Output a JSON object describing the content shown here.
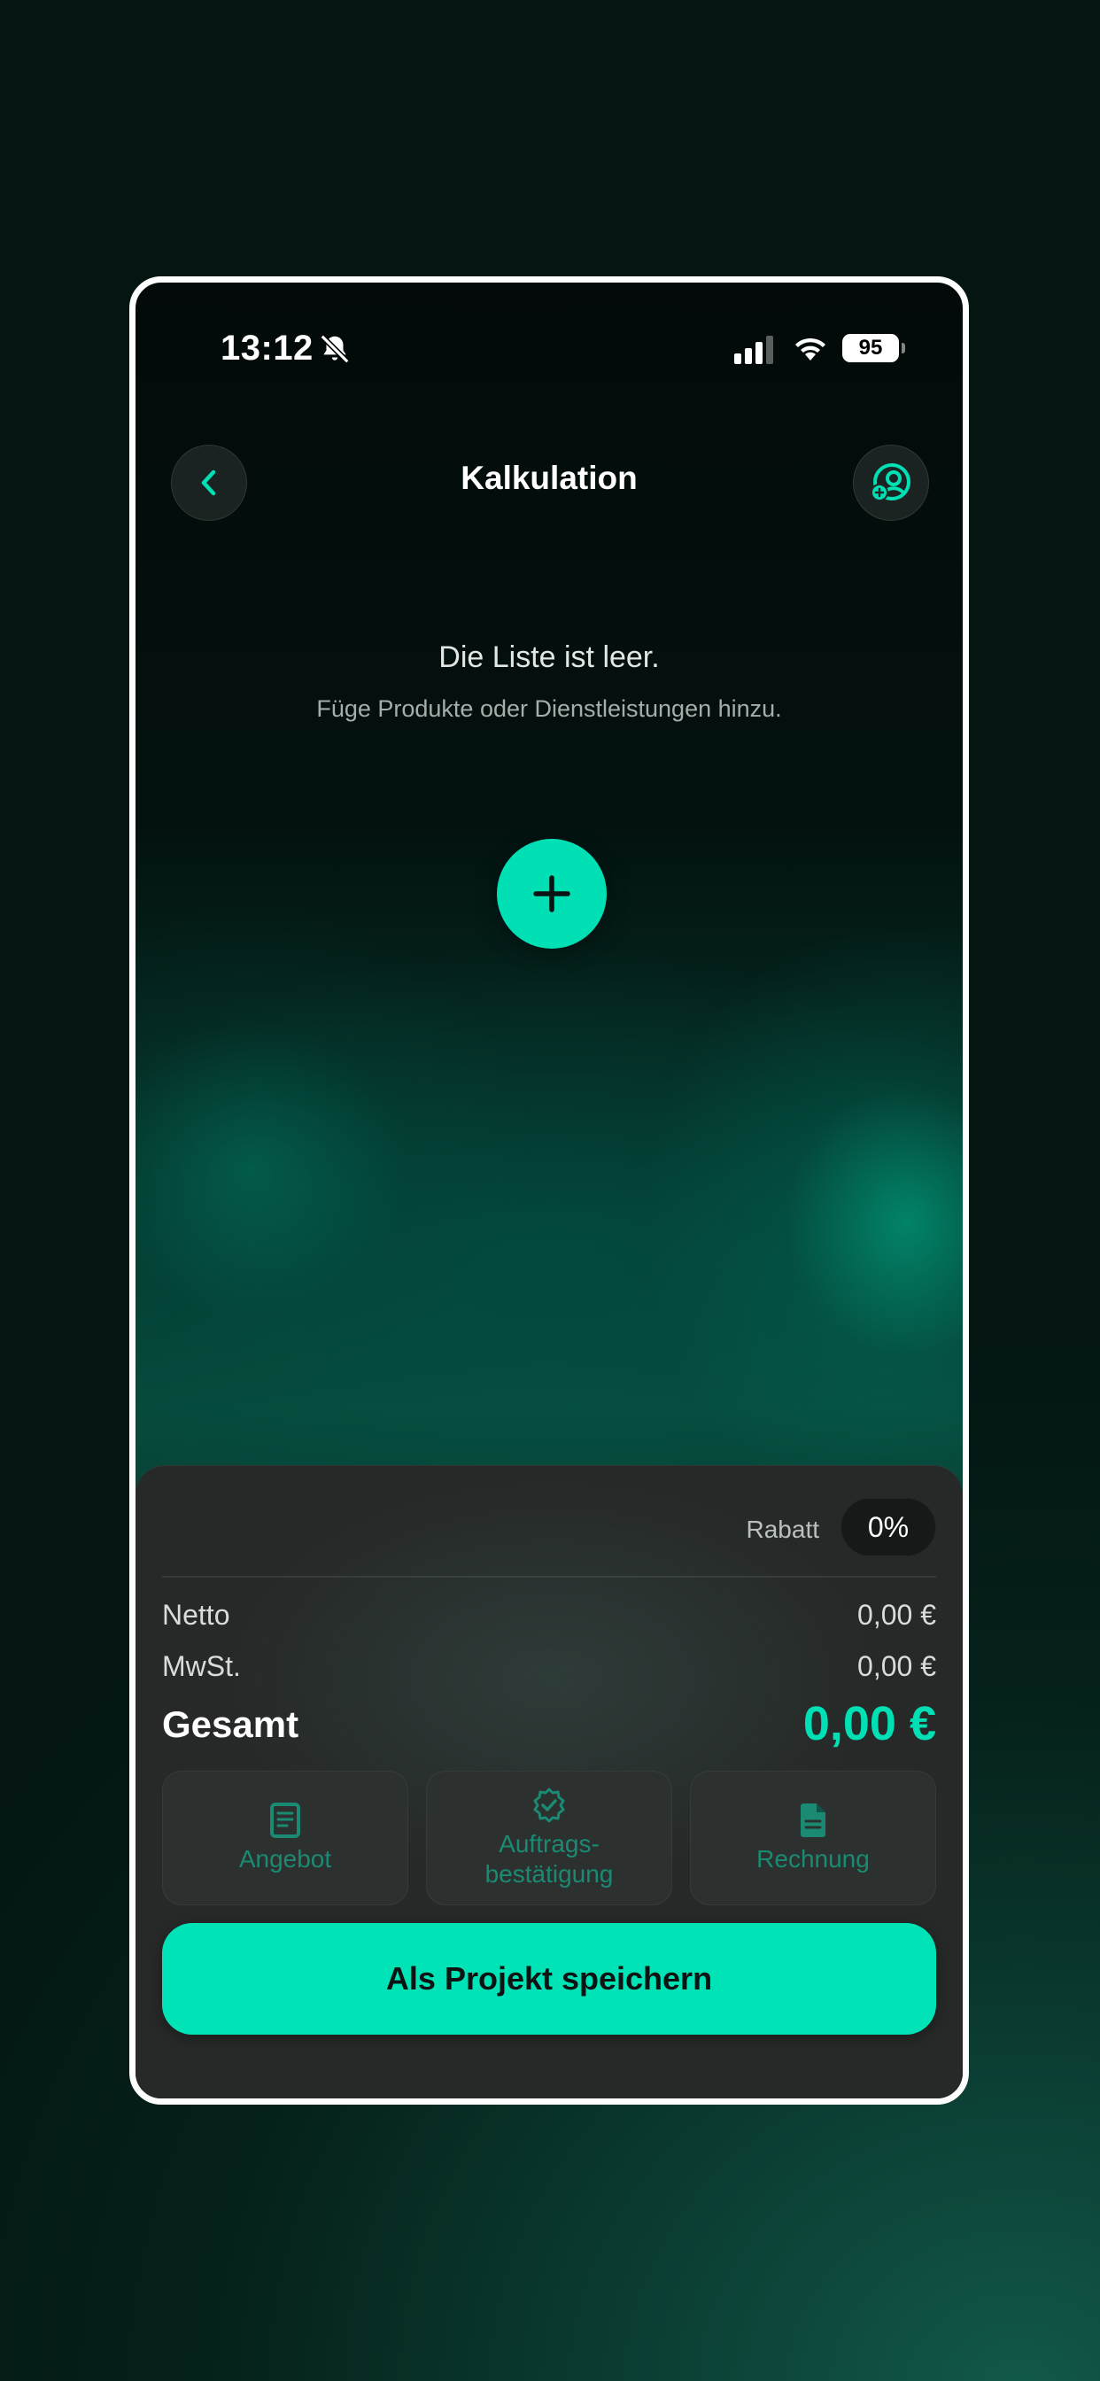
{
  "status_bar": {
    "time": "13:12",
    "battery": "95",
    "icons": [
      "bell-slash-icon",
      "cellular-signal-icon",
      "wifi-icon",
      "battery-icon"
    ]
  },
  "header": {
    "title": "Kalkulation",
    "back_icon": "chevron-left-icon",
    "profile_icon": "user-add-icon"
  },
  "empty_state": {
    "title": "Die Liste ist leer.",
    "subtitle": "Füge Produkte oder Dienstleistungen hinzu.",
    "add_icon": "plus-icon"
  },
  "summary": {
    "discount_label": "Rabatt",
    "discount_value": "0%",
    "net_label": "Netto",
    "net_value": "0,00 €",
    "vat_label": "MwSt.",
    "vat_value": "0,00 €",
    "total_label": "Gesamt",
    "total_value": "0,00 €"
  },
  "documents": [
    {
      "label": "Angebot",
      "icon": "document-icon"
    },
    {
      "label_line1": "Auftrags-",
      "label_line2": "bestätigung",
      "icon": "badge-check-icon"
    },
    {
      "label": "Rechnung",
      "icon": "file-icon"
    }
  ],
  "actions": {
    "save_label": "Als Projekt speichern"
  },
  "colors": {
    "accent": "#00e0b4",
    "sheet_background": "#262928",
    "tile_text": "#1a8a72"
  }
}
